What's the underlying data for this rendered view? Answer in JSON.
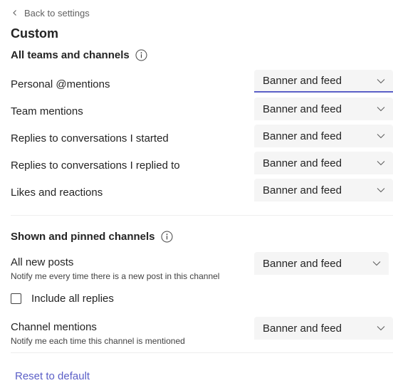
{
  "back_link": {
    "label": "Back to settings"
  },
  "page_title": "Custom",
  "sections": [
    {
      "title": "All teams and channels",
      "rows": [
        {
          "label": "Personal @mentions",
          "value": "Banner and feed"
        },
        {
          "label": "Team mentions",
          "value": "Banner and feed"
        },
        {
          "label": "Replies to conversations I started",
          "value": "Banner and feed"
        },
        {
          "label": "Replies to conversations I replied to",
          "value": "Banner and feed"
        },
        {
          "label": "Likes and reactions",
          "value": "Banner and feed"
        }
      ]
    },
    {
      "title": "Shown and pinned channels",
      "rows": [
        {
          "label": "All new posts",
          "description": "Notify me every time there is a new post in this channel",
          "value": "Banner and feed"
        },
        {
          "label": "Channel mentions",
          "description": "Notify me each time this channel is mentioned",
          "value": "Banner and feed"
        }
      ],
      "checkbox": {
        "label": "Include all replies",
        "checked": false
      }
    }
  ],
  "reset_link": {
    "label": "Reset to default"
  },
  "colors": {
    "accent": "#5b5fc7",
    "field_bg": "#f5f5f5",
    "text": "#242424"
  }
}
